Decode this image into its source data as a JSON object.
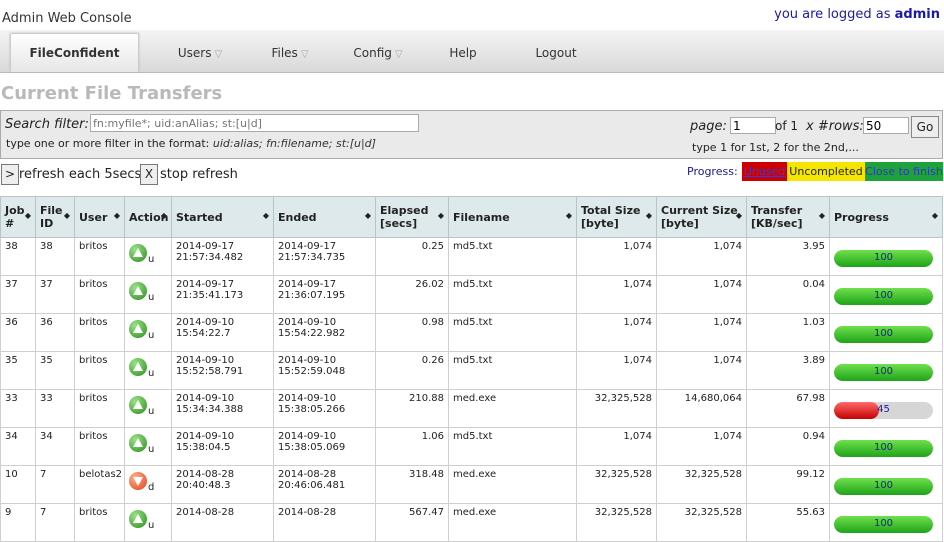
{
  "header": {
    "app_title": "Admin Web Console",
    "login_prefix": "you are logged as",
    "user": "admin"
  },
  "nav": {
    "brand": "FileConfident",
    "items": [
      {
        "label": "Users",
        "dropdown": true
      },
      {
        "label": "Files",
        "dropdown": true
      },
      {
        "label": "Config",
        "dropdown": true
      },
      {
        "label": "Help",
        "dropdown": false
      },
      {
        "label": "Logout",
        "dropdown": false
      }
    ]
  },
  "page_title": "Current File Transfers",
  "search": {
    "label": "Search filter:",
    "placeholder": "fn:myfile*; uid:anAlias; st:[u|d]",
    "hint_prefix": "type one or more filter in the format:",
    "hint_format": "uid:alias; fn:filename; st:[u|d]"
  },
  "paging": {
    "page_label": "page:",
    "page_value": "1",
    "of_label": "of 1",
    "rows_label": "x #rows:",
    "rows_value": "50",
    "go_label": "Go",
    "hint": "type 1 for 1st, 2 for the 2nd,..."
  },
  "refresh": {
    "refresh_button": ">",
    "refresh_label": "refresh each 5secs",
    "stop_button": "X",
    "stop_label": "stop refresh"
  },
  "legend": {
    "label": "Progress:",
    "unused": "Unused",
    "uncompleted": "Uncompleted",
    "close": "Close to finish"
  },
  "colors": {
    "unused": "#cc0000",
    "uncompleted": "#f5e600",
    "close": "#1ea33a",
    "rate": "#cc0000"
  },
  "table": {
    "columns": [
      "Job #",
      "File ID",
      "User",
      "Action",
      "Started",
      "Ended",
      "Elapsed [secs]",
      "Filename",
      "Total Size [byte]",
      "Current Size [byte]",
      "Transfer [KB/sec]",
      "Progress"
    ],
    "rows": [
      {
        "job": "38",
        "file_id": "38",
        "user": "britos",
        "action": "u",
        "action_icon": "upload-icon",
        "started": "2014-09-17 21:57:34.482",
        "ended": "2014-09-17 21:57:34.735",
        "elapsed": "0.25",
        "filename": "md5.txt",
        "total": "1,074",
        "current": "1,074",
        "rate": "3.95",
        "progress": 100,
        "progress_label": "100"
      },
      {
        "job": "37",
        "file_id": "37",
        "user": "britos",
        "action": "u",
        "action_icon": "upload-icon",
        "started": "2014-09-17 21:35:41.173",
        "ended": "2014-09-17 21:36:07.195",
        "elapsed": "26.02",
        "filename": "md5.txt",
        "total": "1,074",
        "current": "1,074",
        "rate": "0.04",
        "progress": 100,
        "progress_label": "100"
      },
      {
        "job": "36",
        "file_id": "36",
        "user": "britos",
        "action": "u",
        "action_icon": "upload-icon",
        "started": "2014-09-10 15:54:22.7",
        "ended": "2014-09-10 15:54:22.982",
        "elapsed": "0.98",
        "filename": "md5.txt",
        "total": "1,074",
        "current": "1,074",
        "rate": "1.03",
        "progress": 100,
        "progress_label": "100"
      },
      {
        "job": "35",
        "file_id": "35",
        "user": "britos",
        "action": "u",
        "action_icon": "upload-icon",
        "started": "2014-09-10 15:52:58.791",
        "ended": "2014-09-10 15:52:59.048",
        "elapsed": "0.26",
        "filename": "md5.txt",
        "total": "1,074",
        "current": "1,074",
        "rate": "3.89",
        "progress": 100,
        "progress_label": "100"
      },
      {
        "job": "33",
        "file_id": "33",
        "user": "britos",
        "action": "u",
        "action_icon": "upload-icon",
        "started": "2014-09-10 15:34:34.388",
        "ended": "2014-09-10 15:38:05.266",
        "elapsed": "210.88",
        "filename": "med.exe",
        "total": "32,325,528",
        "current": "14,680,064",
        "rate": "67.98",
        "progress": 45,
        "progress_label": "45"
      },
      {
        "job": "34",
        "file_id": "34",
        "user": "britos",
        "action": "u",
        "action_icon": "upload-icon",
        "started": "2014-09-10 15:38:04.5",
        "ended": "2014-09-10 15:38:05.069",
        "elapsed": "1.06",
        "filename": "md5.txt",
        "total": "1,074",
        "current": "1,074",
        "rate": "0.94",
        "progress": 100,
        "progress_label": "100"
      },
      {
        "job": "10",
        "file_id": "7",
        "user": "belotas2",
        "action": "d",
        "action_icon": "download-icon",
        "started": "2014-08-28 20:40:48.3",
        "ended": "2014-08-28 20:46:06.481",
        "elapsed": "318.48",
        "filename": "med.exe",
        "total": "32,325,528",
        "current": "32,325,528",
        "rate": "99.12",
        "progress": 100,
        "progress_label": "100"
      },
      {
        "job": "9",
        "file_id": "7",
        "user": "britos",
        "action": "u",
        "action_icon": "upload-icon",
        "started": "2014-08-28",
        "ended": "2014-08-28",
        "elapsed": "567.47",
        "filename": "med.exe",
        "total": "32,325,528",
        "current": "32,325,528",
        "rate": "55.63",
        "progress": 100,
        "progress_label": "100"
      }
    ]
  }
}
